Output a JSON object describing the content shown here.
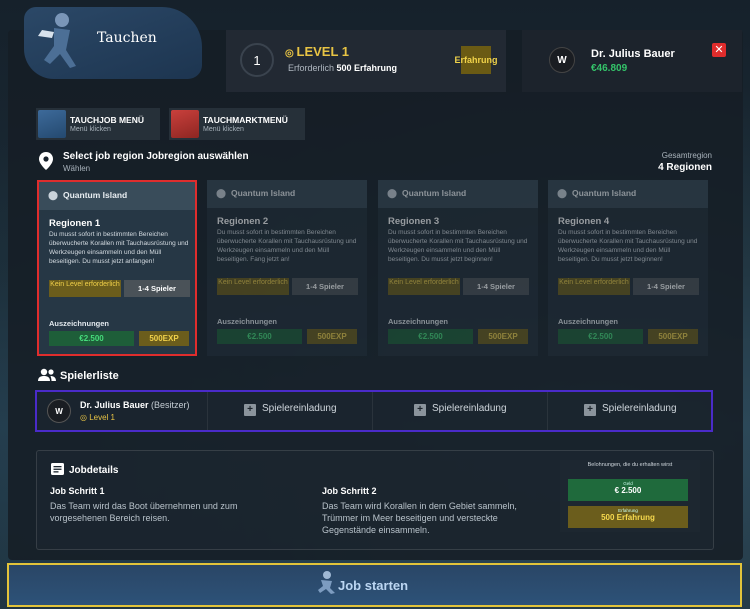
{
  "header": {
    "title": "Tauchen",
    "level_number": "1",
    "level_title": "LEVEL 1",
    "required_prefix": "Erforderlich",
    "required_value": "500 Erfahrung",
    "xp_badge": "Erfahrung",
    "user_logo": "W",
    "user_name": "Dr. Julius Bauer",
    "user_money": "€46.809",
    "close_icon": "x-icon"
  },
  "menu": {
    "job_menu": {
      "title": "TAUCHJOB MENÜ",
      "sub": "Menü klicken"
    },
    "market_menu": {
      "title": "TAUCHMARKTMENÜ",
      "sub": "Menü klicken"
    }
  },
  "region_select": {
    "title": "Select job region Jobregion auswählen",
    "subtitle": "Wählen",
    "total_label": "Gesamtregion",
    "total_value": "4 Regionen"
  },
  "regions": [
    {
      "location": "Quantum Island",
      "title": "Regionen 1",
      "desc": "Du musst sofort in bestimmten Bereichen überwucherte Korallen mit Tauchausrüstung und Werkzeugen einsammeln und den Müll beseitigen. Du musst jetzt anfangen!",
      "no_level": "Kein Level erforderlich",
      "players": "1-4 Spieler",
      "awards": "Auszeichnungen",
      "money": "€2.500",
      "exp": "500EXP"
    },
    {
      "location": "Quantum Island",
      "title": "Regionen 2",
      "desc": "Du musst sofort in bestimmten Bereichen überwucherte Korallen mit Tauchausrüstung und Werkzeugen einsammeln und den Müll beseitigen. Fang jetzt an!",
      "no_level": "Kein Level erforderlich",
      "players": "1-4 Spieler",
      "awards": "Auszeichnungen",
      "money": "€2.500",
      "exp": "500EXP"
    },
    {
      "location": "Quantum Island",
      "title": "Regionen 3",
      "desc": "Du musst sofort in bestimmten Bereichen überwucherte Korallen mit Tauchausrüstung und Werkzeugen einsammeln und den Müll beseitigen. Du musst jetzt beginnen!",
      "no_level": "Kein Level erforderlich",
      "players": "1-4 Spieler",
      "awards": "Auszeichnungen",
      "money": "€2.500",
      "exp": "500EXP"
    },
    {
      "location": "Quantum Island",
      "title": "Regionen 4",
      "desc": "Du musst sofort in bestimmten Bereichen überwucherte Korallen mit Tauchausrüstung und Werkzeugen einsammeln und den Müll beseitigen. Du musst jetzt beginnen!",
      "no_level": "Kein Level erforderlich",
      "players": "1-4 Spieler",
      "awards": "Auszeichnungen",
      "money": "€2.500",
      "exp": "500EXP"
    }
  ],
  "players": {
    "title": "Spielerliste",
    "owner": {
      "logo": "W",
      "name": "Dr. Julius Bauer",
      "role": "(Besitzer)",
      "level": "Level 1"
    },
    "invites": [
      "Spielereinladung",
      "Spielereinladung",
      "Spielereinladung"
    ]
  },
  "job_details": {
    "title": "Jobdetails",
    "steps": [
      {
        "title": "Job Schritt 1",
        "desc": "Das Team wird das Boot übernehmen und zum vorgesehenen Bereich reisen."
      },
      {
        "title": "Job Schritt 2",
        "desc": "Das Team wird Korallen in dem Gebiet sammeln, Trümmer im Meer beseitigen und versteckte Gegenstände einsammeln."
      }
    ],
    "rewards": {
      "heading": "Belohnungen, die du erhalten wirst",
      "money_label": "Geld",
      "money_value": "€ 2.500",
      "exp_label": "Erfahrung",
      "exp_value": "500 Erfahrung"
    }
  },
  "start_button": "Job starten",
  "colors": {
    "accent_gold": "#e8c444",
    "money_green": "#34c46a",
    "selected_border": "#e02d2d",
    "player_border": "#4a2bc9"
  }
}
